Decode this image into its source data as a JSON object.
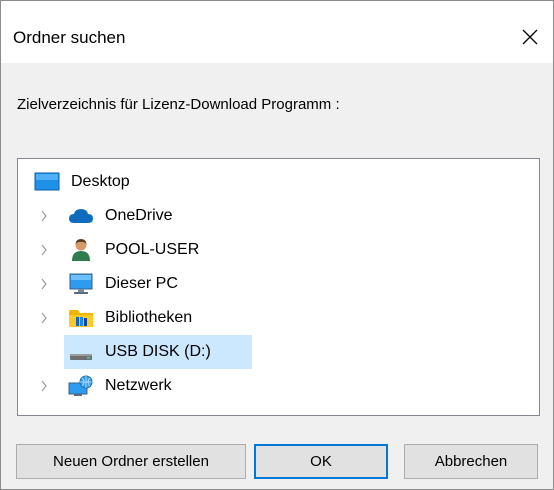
{
  "window": {
    "title": "Ordner suchen",
    "close_icon": "close-icon"
  },
  "instruction": "Zielverzeichnis für Lizenz-Download Programm :",
  "tree": {
    "items": [
      {
        "label": "Desktop",
        "icon": "desktop-icon",
        "expandable": false,
        "selected": false
      },
      {
        "label": "OneDrive",
        "icon": "cloud-icon",
        "expandable": true,
        "selected": false
      },
      {
        "label": "POOL-USER",
        "icon": "user-icon",
        "expandable": true,
        "selected": false
      },
      {
        "label": "Dieser PC",
        "icon": "computer-icon",
        "expandable": true,
        "selected": false
      },
      {
        "label": "Bibliotheken",
        "icon": "library-folder-icon",
        "expandable": true,
        "selected": false
      },
      {
        "label": "USB DISK (D:)",
        "icon": "usb-drive-icon",
        "expandable": false,
        "selected": true
      },
      {
        "label": "Netzwerk",
        "icon": "network-icon",
        "expandable": true,
        "selected": false
      }
    ]
  },
  "buttons": {
    "new_folder": "Neuen Ordner erstellen",
    "ok": "OK",
    "cancel": "Abbrechen"
  },
  "colors": {
    "selection": "#cce8ff",
    "accent": "#0078d7",
    "dialog_background": "#f0f0f0"
  }
}
